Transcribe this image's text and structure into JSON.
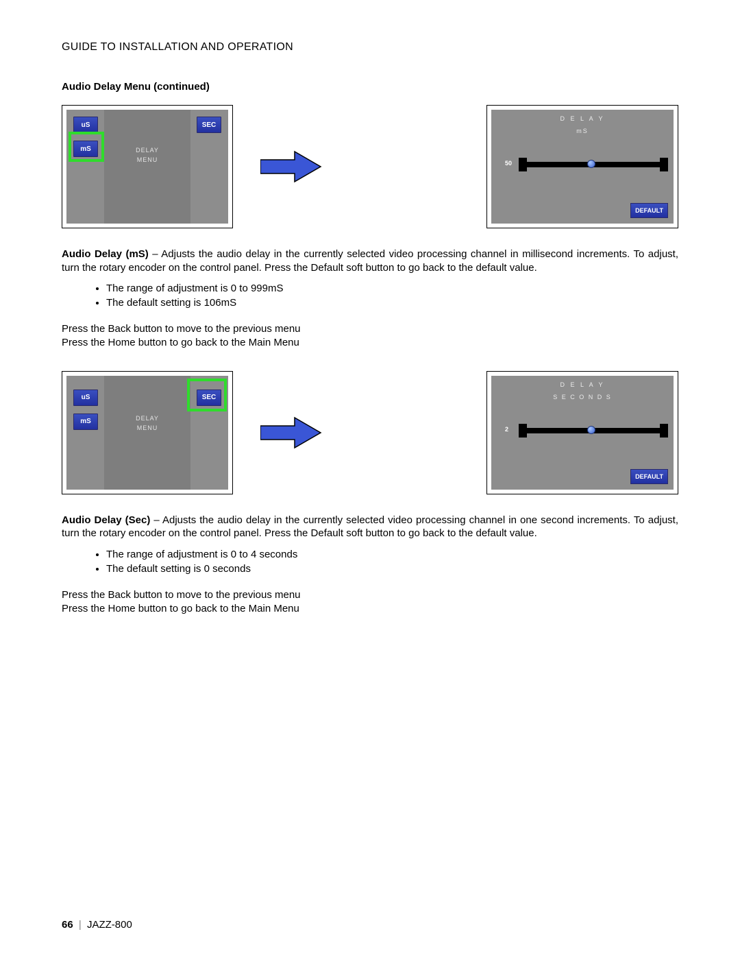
{
  "header": {
    "title": "GUIDE TO INSTALLATION AND OPERATION"
  },
  "section": {
    "title": "Audio Delay Menu (continued)"
  },
  "panel_small_1": {
    "btn_us": "uS",
    "btn_ms": "mS",
    "btn_sec": "SEC",
    "center_line1": "DELAY",
    "center_line2": "MENU"
  },
  "panel_large_1": {
    "title": "D E L A Y",
    "subtitle": "mS",
    "value": "50",
    "default_btn": "DEFAULT"
  },
  "text1": {
    "lead_bold": "Audio Delay (mS)",
    "para": " – Adjusts the audio delay in the currently selected video processing channel in millisecond increments. To adjust, turn the rotary encoder on the control panel. Press the Default soft button to go back to the default value.",
    "bullet1": "The range of adjustment is 0 to 999mS",
    "bullet2": "The default setting is 106mS",
    "nav1": "Press the Back button to move to the previous menu",
    "nav2": "Press the Home button to go back to the Main Menu"
  },
  "panel_small_2": {
    "btn_us": "uS",
    "btn_ms": "mS",
    "btn_sec": "SEC",
    "center_line1": "DELAY",
    "center_line2": "MENU"
  },
  "panel_large_2": {
    "title": "D E L A Y",
    "subtitle": "S E C O N D S",
    "value": "2",
    "default_btn": "DEFAULT"
  },
  "text2": {
    "lead_bold": "Audio Delay (Sec)",
    "para": " – Adjusts the audio delay in the currently selected video processing channel in one second increments. To adjust, turn the rotary encoder on the control panel. Press the Default soft button to go back to the default value.",
    "bullet1": "The range of adjustment is 0 to 4 seconds",
    "bullet2": "The default setting is 0 seconds",
    "nav1": "Press the Back button to move to the previous menu",
    "nav2": "Press the Home button to go back to the Main Menu"
  },
  "footer": {
    "page": "66",
    "sep": "|",
    "product": "JAZZ-800"
  }
}
